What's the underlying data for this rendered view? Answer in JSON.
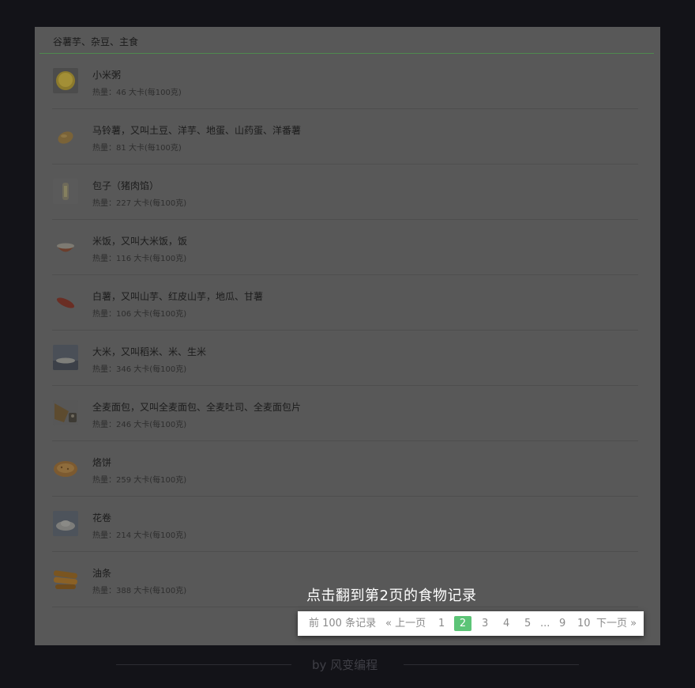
{
  "category_title": "谷薯芋、杂豆、主食",
  "foods": [
    {
      "name": "小米粥",
      "calories": "热量：46 大卡(每100克)",
      "icon": "millet-porridge-icon"
    },
    {
      "name": "马铃薯，又叫土豆、洋芋、地蛋、山药蛋、洋番薯",
      "calories": "热量：81 大卡(每100克)",
      "icon": "potato-icon"
    },
    {
      "name": "包子（猪肉馅）",
      "calories": "热量：227 大卡(每100克)",
      "icon": "steamed-bun-icon"
    },
    {
      "name": "米饭，又叫大米饭，饭",
      "calories": "热量：116 大卡(每100克)",
      "icon": "rice-bowl-icon"
    },
    {
      "name": "白薯，又叫山芋、红皮山芋，地瓜、甘薯",
      "calories": "热量：106 大卡(每100克)",
      "icon": "sweet-potato-icon"
    },
    {
      "name": "大米，又叫稻米、米、生米",
      "calories": "热量：346 大卡(每100克)",
      "icon": "raw-rice-icon"
    },
    {
      "name": "全麦面包，又叫全麦面包、全麦吐司、全麦面包片",
      "calories": "热量：246 大卡(每100克)",
      "icon": "whole-wheat-bread-icon"
    },
    {
      "name": "烙饼",
      "calories": "热量：259 大卡(每100克)",
      "icon": "pancake-icon"
    },
    {
      "name": "花卷",
      "calories": "热量：214 大卡(每100克)",
      "icon": "flower-roll-icon"
    },
    {
      "name": "油条",
      "calories": "热量：388 大卡(每100克)",
      "icon": "fried-dough-stick-icon"
    }
  ],
  "overlay_caption": "点击翻到第2页的食物记录",
  "pagination": {
    "summary": "前 100 条记录",
    "prev": "« 上一页",
    "pages": [
      "1",
      "2",
      "3",
      "4",
      "5"
    ],
    "ellipsis": "...",
    "tail_pages": [
      "9",
      "10"
    ],
    "next": "下一页 »",
    "current": "2",
    "active_color": "#5cc477"
  },
  "footer": "by 风变编程"
}
